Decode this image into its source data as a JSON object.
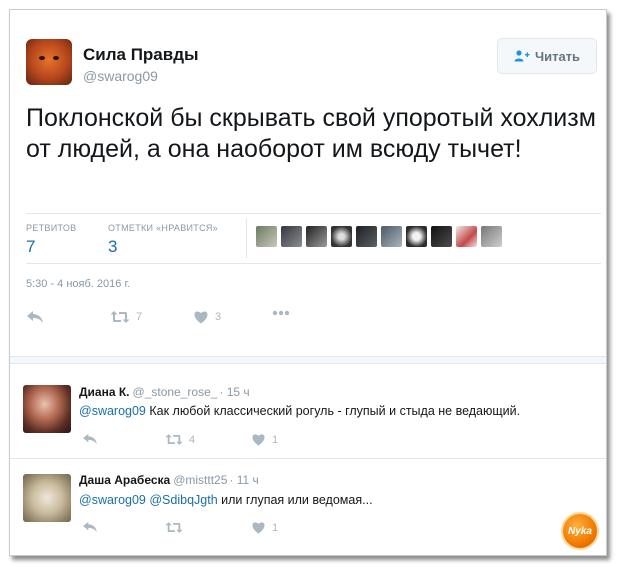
{
  "tweet": {
    "author_name": "Сила Правды",
    "author_handle": "@swarog09",
    "follow_label": "Читать",
    "text": "Поклонской бы скрывать свой упоротый хохлизм от людей, а она наоборот им всюду тычет!",
    "retweets_label": "РЕТВИТОВ",
    "retweets_count": "7",
    "likes_label": "ОТМЕТКИ «НРАВИТСЯ»",
    "likes_count": "3",
    "timestamp": "5:30 - 4 нояб. 2016 г.",
    "action_retweet_count": "7",
    "action_like_count": "3"
  },
  "replies": [
    {
      "name": "Диана К.",
      "handle": "@_stone_rose_",
      "time": "· 15 ч",
      "mention": "@swarog09",
      "text": " Как любой классический рогуль - глупый и стыда не ведающий.",
      "retweets": "4",
      "likes": "1"
    },
    {
      "name": "Даша Арабеска",
      "handle": "@misttt25",
      "time": "· 11 ч",
      "mention": "@swarog09 @SdibqJgth",
      "text": " или глупая или ведомая...",
      "retweets": "",
      "likes": "1"
    }
  ],
  "watermark_text": "Nyka",
  "colors": {
    "link": "#1b6fa8",
    "muted": "#8899a6",
    "icon": "#aab8c2"
  }
}
